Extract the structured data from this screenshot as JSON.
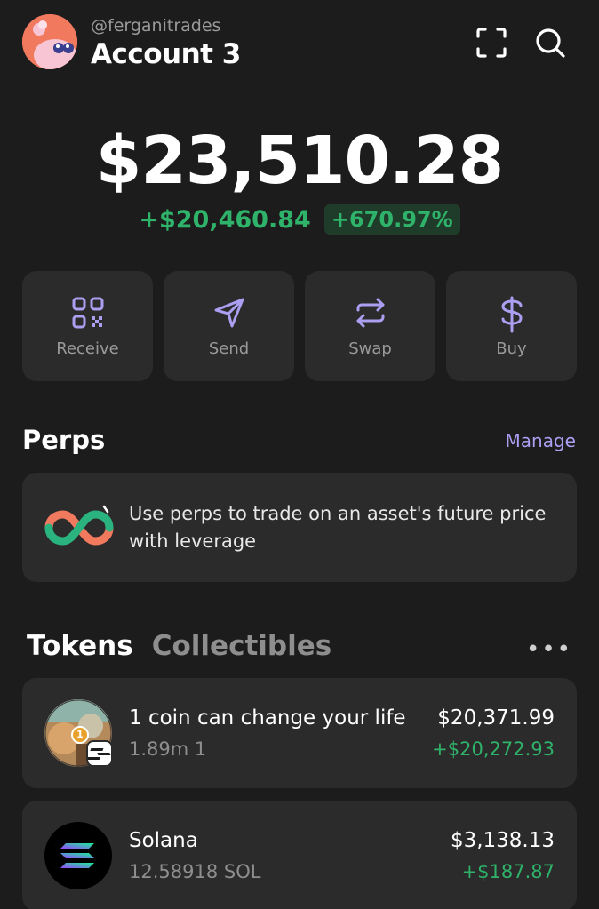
{
  "header": {
    "handle": "@ferganitrades",
    "account_name": "Account 3"
  },
  "balance": {
    "total": "$23,510.28",
    "change_amount": "+$20,460.84",
    "change_percent": "+670.97%"
  },
  "actions": [
    {
      "label": "Receive",
      "icon": "qr-code-icon"
    },
    {
      "label": "Send",
      "icon": "send-icon"
    },
    {
      "label": "Swap",
      "icon": "swap-icon"
    },
    {
      "label": "Buy",
      "icon": "dollar-icon"
    }
  ],
  "perps": {
    "title": "Perps",
    "manage_label": "Manage",
    "description": "Use perps to trade on an asset's future price with leverage"
  },
  "tabs": {
    "tokens": "Tokens",
    "collectibles": "Collectibles"
  },
  "tokens": [
    {
      "name": "1 coin can change your life",
      "amount": "1.89m 1",
      "value": "$20,371.99",
      "change": "+$20,272.93",
      "badge": "1"
    },
    {
      "name": "Solana",
      "amount": "12.58918 SOL",
      "value": "$3,138.13",
      "change": "+$187.87"
    }
  ],
  "colors": {
    "accent": "#ab9ff2",
    "positive": "#2fb36a",
    "background": "#1c1c1c",
    "card": "#2b2b2b"
  }
}
